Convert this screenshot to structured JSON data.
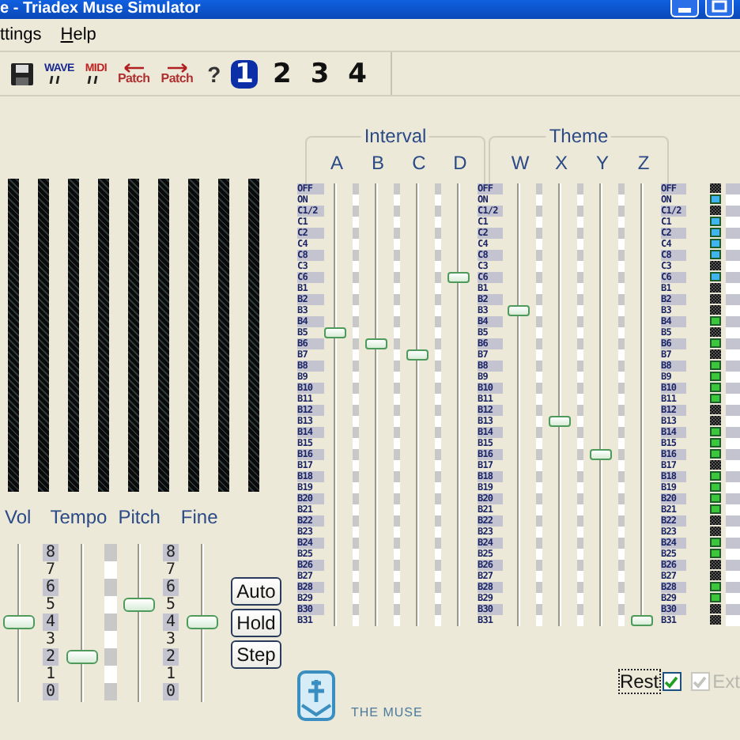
{
  "window": {
    "title": "e - Triadex Muse Simulator"
  },
  "menu": [
    {
      "label": "ttings"
    },
    {
      "label": "Help"
    }
  ],
  "toolbar": [
    {
      "kind": "save"
    },
    {
      "kind": "wave",
      "label": "WAVE"
    },
    {
      "kind": "midi",
      "label": "MIDI"
    },
    {
      "kind": "patch-in",
      "label": "Patch"
    },
    {
      "kind": "patch-out",
      "label": "Patch"
    },
    {
      "kind": "help",
      "label": "?"
    }
  ],
  "patterns": [
    {
      "label": "1",
      "selected": true
    },
    {
      "label": "2",
      "selected": false
    },
    {
      "label": "3",
      "selected": false
    },
    {
      "label": "4",
      "selected": false
    }
  ],
  "interval": {
    "title": "Interval",
    "labels": [
      "OFF",
      "ON",
      "C1/2",
      "C1",
      "C2",
      "C4",
      "C8",
      "C3",
      "C6",
      "B1",
      "B2",
      "B3",
      "B4",
      "B5",
      "B6",
      "B7",
      "B8",
      "B9",
      "B10",
      "B11",
      "B12",
      "B13",
      "B14",
      "B15",
      "B16",
      "B17",
      "B18",
      "B19",
      "B20",
      "B21",
      "B22",
      "B23",
      "B24",
      "B25",
      "B26",
      "B27",
      "B28",
      "B29",
      "B30",
      "B31"
    ],
    "sliders": [
      {
        "name": "A",
        "level": 0.667
      },
      {
        "name": "B",
        "level": 0.641
      },
      {
        "name": "C",
        "level": 0.615
      },
      {
        "name": "D",
        "level": 0.795
      }
    ]
  },
  "theme": {
    "title": "Theme",
    "labels": [
      "OFF",
      "ON",
      "C1/2",
      "C1",
      "C2",
      "C4",
      "C8",
      "C3",
      "C6",
      "B1",
      "B2",
      "B3",
      "B4",
      "B5",
      "B6",
      "B7",
      "B8",
      "B9",
      "B10",
      "B11",
      "B12",
      "B13",
      "B14",
      "B15",
      "B16",
      "B17",
      "B18",
      "B19",
      "B20",
      "B21",
      "B22",
      "B23",
      "B24",
      "B25",
      "B26",
      "B27",
      "B28",
      "B29",
      "B30",
      "B31"
    ],
    "sliders": [
      {
        "name": "W",
        "level": 0.718
      },
      {
        "name": "X",
        "level": 0.462
      },
      {
        "name": "Y",
        "level": 0.385
      },
      {
        "name": "Z",
        "level": 0
      }
    ]
  },
  "indicators": [
    {
      "label": "OFF",
      "lit": false
    },
    {
      "label": "ON",
      "lit": true,
      "color": "#3fb4ee"
    },
    {
      "label": "C1/2",
      "lit": false
    },
    {
      "label": "C1",
      "lit": true,
      "color": "#3fb4ee"
    },
    {
      "label": "C2",
      "lit": true,
      "color": "#3fb4ee"
    },
    {
      "label": "C4",
      "lit": true,
      "color": "#3fb4ee"
    },
    {
      "label": "C8",
      "lit": true,
      "color": "#3fb4ee"
    },
    {
      "label": "C3",
      "lit": false
    },
    {
      "label": "C6",
      "lit": true,
      "color": "#3fb4ee"
    },
    {
      "label": "B1",
      "lit": false
    },
    {
      "label": "B2",
      "lit": false
    },
    {
      "label": "B3",
      "lit": false
    },
    {
      "label": "B4",
      "lit": true,
      "color": "#3cc63c"
    },
    {
      "label": "B5",
      "lit": false
    },
    {
      "label": "B6",
      "lit": true,
      "color": "#3cc63c"
    },
    {
      "label": "B7",
      "lit": false
    },
    {
      "label": "B8",
      "lit": true,
      "color": "#3cc63c"
    },
    {
      "label": "B9",
      "lit": true,
      "color": "#3cc63c"
    },
    {
      "label": "B10",
      "lit": true,
      "color": "#3cc63c"
    },
    {
      "label": "B11",
      "lit": true,
      "color": "#3cc63c"
    },
    {
      "label": "B12",
      "lit": false
    },
    {
      "label": "B13",
      "lit": false
    },
    {
      "label": "B14",
      "lit": true,
      "color": "#3cc63c"
    },
    {
      "label": "B15",
      "lit": true,
      "color": "#3cc63c"
    },
    {
      "label": "B16",
      "lit": true,
      "color": "#3cc63c"
    },
    {
      "label": "B17",
      "lit": false
    },
    {
      "label": "B18",
      "lit": true,
      "color": "#3cc63c"
    },
    {
      "label": "B19",
      "lit": true,
      "color": "#3cc63c"
    },
    {
      "label": "B20",
      "lit": true,
      "color": "#3cc63c"
    },
    {
      "label": "B21",
      "lit": true,
      "color": "#3cc63c"
    },
    {
      "label": "B22",
      "lit": false
    },
    {
      "label": "B23",
      "lit": false
    },
    {
      "label": "B24",
      "lit": true,
      "color": "#3cc63c"
    },
    {
      "label": "B25",
      "lit": true,
      "color": "#3cc63c"
    },
    {
      "label": "B26",
      "lit": false
    },
    {
      "label": "B27",
      "lit": false
    },
    {
      "label": "B28",
      "lit": true,
      "color": "#3cc63c"
    },
    {
      "label": "B29",
      "lit": true,
      "color": "#3cc63c"
    },
    {
      "label": "B30",
      "lit": false
    },
    {
      "label": "B31",
      "lit": false
    }
  ],
  "controls": {
    "sliders": [
      {
        "name": "Vol",
        "level": 0.5
      },
      {
        "name": "Tempo",
        "level": 0.25
      },
      {
        "name": "Pitch",
        "level": 0.625
      },
      {
        "name": "Fine",
        "level": 0.5
      }
    ],
    "tempo_scale": [
      "8",
      "7",
      "6",
      "5",
      "4",
      "3",
      "2",
      "1",
      "0"
    ],
    "fine_scale": [
      "8",
      "7",
      "6",
      "5",
      "4",
      "3",
      "2",
      "1",
      "0"
    ],
    "buttons": [
      "Auto",
      "Hold",
      "Step"
    ]
  },
  "logo": {
    "text": "THE MUSE"
  },
  "options": [
    {
      "label": "Rest",
      "checked": true,
      "disabled": false,
      "focused": true
    },
    {
      "label": "Ext",
      "checked": true,
      "disabled": true,
      "focused": false
    }
  ]
}
